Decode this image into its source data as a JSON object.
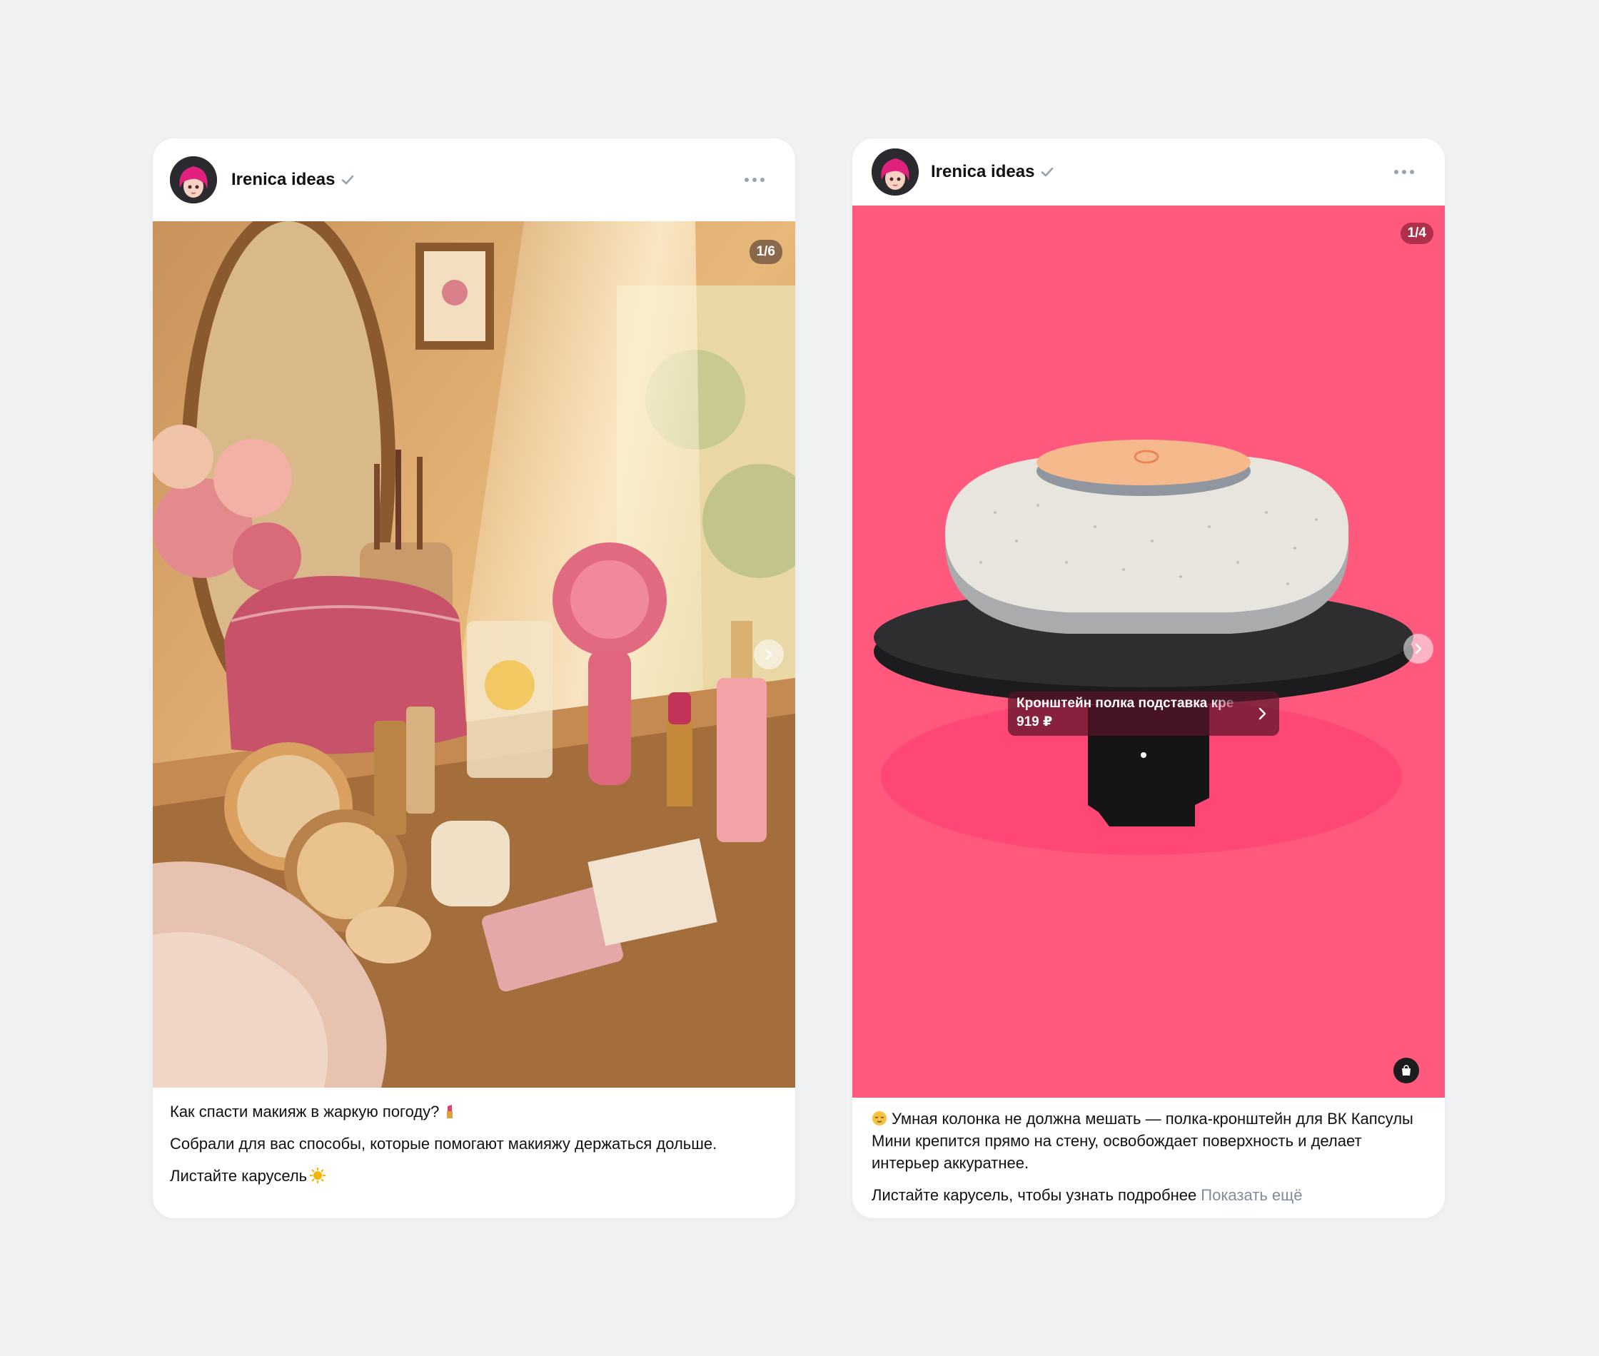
{
  "posts": [
    {
      "author": "Irenica ideas",
      "counter": "1/6",
      "text_lines": [
        "Как спасти макияж в жаркую погоду?",
        "Собрали для вас способы, которые помогают макияжу держаться дольше.",
        "Листайте карусель"
      ],
      "image_description_icons": [
        "lipstick-emoji",
        "sun-emoji"
      ]
    },
    {
      "author": "Irenica ideas",
      "counter": "1/4",
      "product": {
        "name": "Кронштейн полка подставка кре",
        "price": "919 ₽"
      },
      "text_lines": [
        "Умная колонка не должна мешать — полка-кронштейн для ВК Капсулы Мини крепится прямо на стену, освобождает поверхность и делает интерьер аккуратнее.",
        "Листайте карусель, чтобы узнать подробнее"
      ],
      "show_more": "Показать ещё"
    }
  ],
  "colors": {
    "background": "#f0f1f3",
    "card": "#ffffff",
    "media_pink": "#ff5a7e",
    "secondary_text": "#818c99"
  },
  "icons": [
    "verified-icon",
    "more-icon",
    "chevron-right-icon",
    "shopping-bag-icon"
  ]
}
